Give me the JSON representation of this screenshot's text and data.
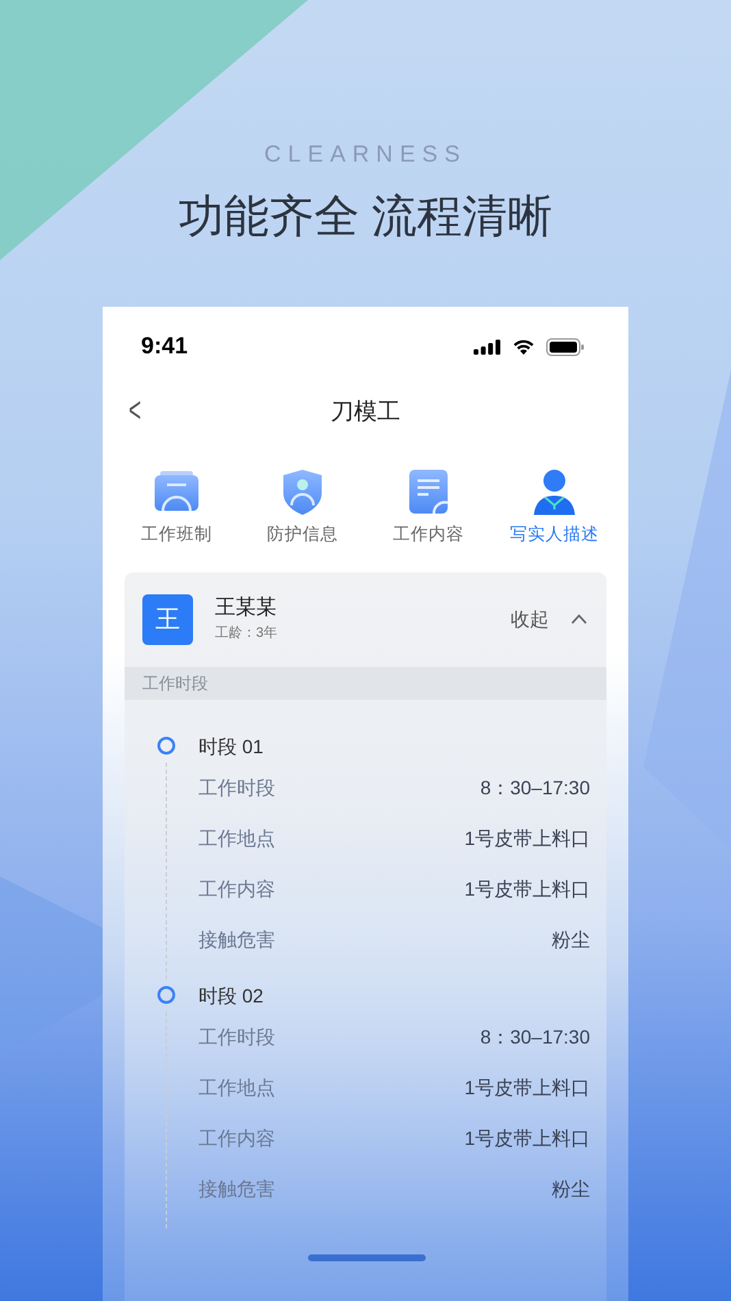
{
  "banner": {
    "subtitle": "CLEARNESS",
    "title": "功能齐全 流程清晰"
  },
  "status_bar": {
    "time": "9:41"
  },
  "nav": {
    "back": "<",
    "title": "刀模工"
  },
  "tabs": [
    {
      "kind": "schedule",
      "label": "工作班制",
      "selected": false
    },
    {
      "kind": "shield",
      "label": "防护信息",
      "selected": false
    },
    {
      "kind": "document",
      "label": "工作内容",
      "selected": false
    },
    {
      "kind": "person",
      "label": "写实人描述",
      "selected": true
    }
  ],
  "worker": {
    "avatar": "王",
    "name": "王某某",
    "seniority": "工龄：3年",
    "toggle": "收起",
    "expanded": true
  },
  "section_title": "工作时段",
  "periods": [
    {
      "title": "时段 01",
      "rows": [
        {
          "label": "工作时段",
          "value": "8：30–17:30"
        },
        {
          "label": "工作地点",
          "value": "1号皮带上料口"
        },
        {
          "label": "工作内容",
          "value": "1号皮带上料口"
        },
        {
          "label": "接触危害",
          "value": "粉尘"
        }
      ]
    },
    {
      "title": "时段 02",
      "rows": [
        {
          "label": "工作时段",
          "value": "8：30–17:30"
        },
        {
          "label": "工作地点",
          "value": "1号皮带上料口"
        },
        {
          "label": "工作内容",
          "value": "1号皮带上料口"
        },
        {
          "label": "接触危害",
          "value": "粉尘"
        }
      ]
    }
  ]
}
